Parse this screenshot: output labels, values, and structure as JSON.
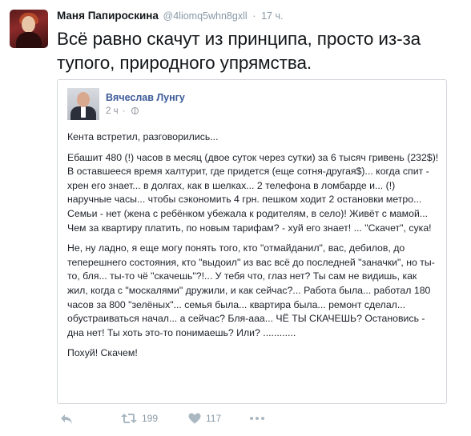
{
  "tweet": {
    "author": {
      "name": "Маня Папироскина",
      "handle": "@4liomq5whn8gxll",
      "separator": "·",
      "time": "17 ч."
    },
    "text": "Всё равно скачут из принципа, просто из-за тупого, природного упрямства.",
    "embedded_post": {
      "author": "Вячеслав Лунгу",
      "time": "2 ч",
      "separator": "·",
      "paragraphs": [
        "Кента встретил, разговорились...",
        "Ебашит 480 (!) часов в месяц (двое суток через сутки) за 6 тысяч гривень (232$)! В оставшееся время халтурит, где придется (еще сотня-другая$)... когда спит - хрен его знает... в долгах, как в шелках... 2 телефона в ломбарде и... (!) наручные часы... чтобы сэкономить 4 грн. пешком ходит 2 остановки метро... Семьи - нет (жена с ребёнком убежала к родителям, в село)! Живёт с мамой... Чем за квартиру платить, по новым тарифам? - хуй его знает! ... \"Скачет\", сука!",
        "Не, ну ладно, я еще могу понять того, кто \"отмайданил\", вас, дебилов, до теперешнего состояния, кто \"выдоил\" из вас всё до последней \"заначки\", но ты-то, бля... ты-то чё \"скачешь\"?!... У тебя что, глаз нет? Ты сам не видишь, как жил, когда с \"москалями\" дружили, и как сейчас?... Работа была... работал 180 часов за 800 \"зелёных\"... семья была... квартира была... ремонт сделал... обустраиваться начал... а сейчас? Бля-ааа... ЧЁ ТЫ СКАЧЕШЬ? Остановись - дна нет! Ты хоть это-то понимаешь? Или? ............",
        "Похуй! Скачем!"
      ]
    },
    "actions": {
      "reply_icon": "reply-icon",
      "retweet_icon": "retweet-icon",
      "retweet_count": "199",
      "like_icon": "heart-icon",
      "like_count": "117",
      "more_icon": "more-icon"
    }
  },
  "colors": {
    "text": "#14171a",
    "muted": "#8899a6",
    "fb_link": "#3b5998",
    "card_border": "#d3d6db"
  }
}
